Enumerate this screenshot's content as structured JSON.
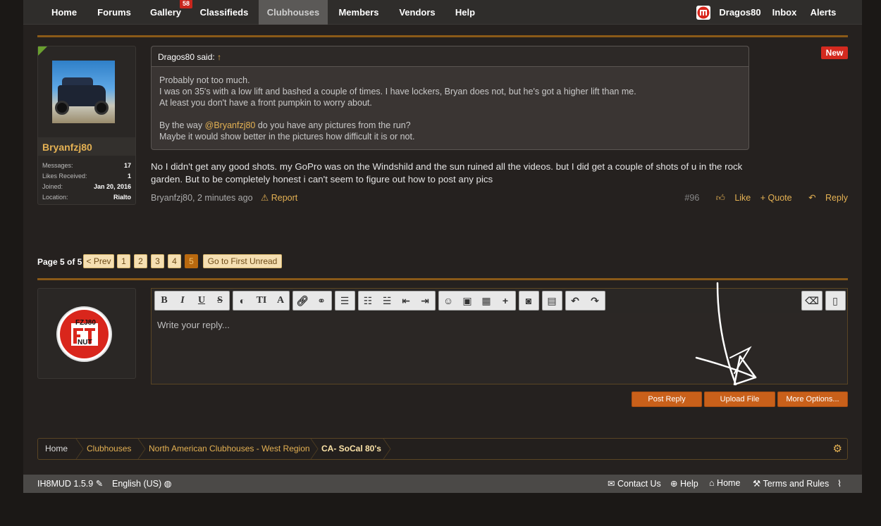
{
  "nav": {
    "tabs": [
      {
        "label": "Home"
      },
      {
        "label": "Forums"
      },
      {
        "label": "Gallery",
        "badge": "58"
      },
      {
        "label": "Classifieds"
      },
      {
        "label": "Clubhouses",
        "active": true
      },
      {
        "label": "Members"
      },
      {
        "label": "Vendors"
      },
      {
        "label": "Help"
      }
    ],
    "user": "Dragos80",
    "inbox": "Inbox",
    "alerts": "Alerts"
  },
  "post": {
    "author": {
      "name": "Bryanfzj80",
      "stats": [
        {
          "label": "Messages:",
          "value": "17"
        },
        {
          "label": "Likes Received:",
          "value": "1"
        },
        {
          "label": "Joined:",
          "value": "Jan 20, 2016"
        },
        {
          "label": "Location:",
          "value": "Rialto"
        }
      ]
    },
    "new_badge": "New",
    "quote": {
      "author": "Dragos80 said:",
      "arrow": "↑",
      "lines": [
        "Probably not too much.",
        "I was on 35's with a low lift and bashed a couple of times. I have lockers, Bryan does not, but he's got a higher lift than me.",
        "At least you don't have a front pumpkin to worry about."
      ],
      "line4_pre": "By the way ",
      "line4_mention": "@Bryanfzj80",
      "line4_post": " do you have any pictures from the run?",
      "line5": "Maybe it would show better in the pictures how difficult it is or not."
    },
    "body_lines": [
      "No I didn't get any good shots. my GoPro was on the Windshild and the sun ruined all the videos. but I did get a couple of shots of u in the rock",
      "garden. But to be completely honest i can't seem to figure out how to post any pics"
    ],
    "meta": "Bryanfzj80, 2 minutes ago",
    "report": "Report",
    "number": "#96",
    "like": "Like",
    "quote_action": "+ Quote",
    "reply": "Reply"
  },
  "pagination": {
    "label": "Page 5 of 5",
    "prev": "< Prev",
    "pages": [
      "1",
      "2",
      "3",
      "4",
      "5"
    ],
    "current": "5",
    "first_unread": "Go to First Unread"
  },
  "reply_logo": {
    "top": "FZJ80",
    "bottom": "NUT"
  },
  "editor": {
    "placeholder": "Write your reply...",
    "tools": [
      "bold-icon",
      "italic-icon",
      "underline-icon",
      "strikethrough-icon",
      "color-icon",
      "font-size-icon",
      "font-family-icon",
      "link-icon",
      "unlink-icon",
      "align-icon",
      "bullet-list-icon",
      "number-list-icon",
      "outdent-icon",
      "indent-icon",
      "smilie-icon",
      "image-icon",
      "media-icon",
      "insert-icon",
      "camera-icon",
      "save-icon",
      "undo-icon",
      "redo-icon",
      "eraser-icon",
      "source-icon"
    ]
  },
  "buttons": {
    "post_reply": "Post Reply",
    "upload_file": "Upload File",
    "more_options": "More Options..."
  },
  "breadcrumb": [
    "Home",
    "Clubhouses",
    "North American Clubhouses - West Region",
    "CA- SoCal 80's"
  ],
  "footer": {
    "version": "IH8MUD 1.5.9",
    "language": "English (US)",
    "contact": "Contact Us",
    "help": "Help",
    "home": "Home",
    "terms": "Terms and Rules"
  },
  "colors": {
    "accent": "#e4b153",
    "divider": "#8a5a18",
    "button": "#c9601a",
    "badge": "#d42a1f"
  }
}
